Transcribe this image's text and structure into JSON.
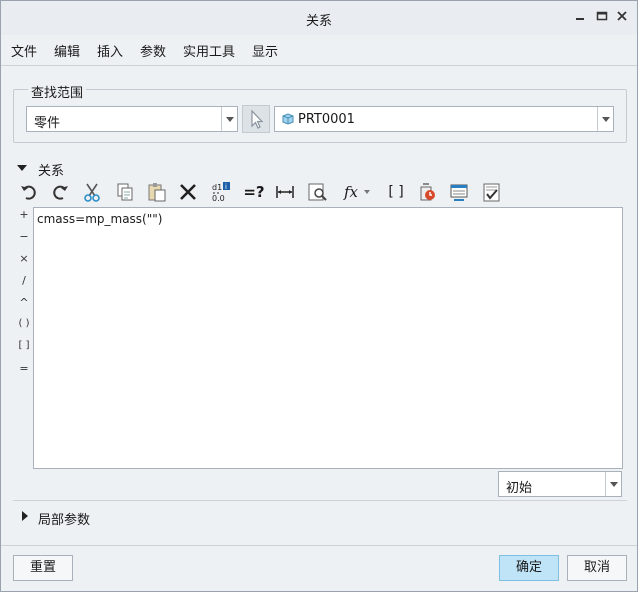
{
  "window": {
    "title": "关系"
  },
  "menu": {
    "items": [
      "文件",
      "编辑",
      "插入",
      "参数",
      "实用工具",
      "显示"
    ]
  },
  "lookin": {
    "group_label": "查找范围",
    "type_value": "零件",
    "object_value": "PRT0001"
  },
  "relations": {
    "section_label": "关系",
    "code": "cmass=mp_mass(\"\")",
    "operators": [
      "+",
      "−",
      "×",
      "/",
      "^",
      "( )",
      "[ ]",
      "="
    ],
    "status_value": "初始"
  },
  "local_params": {
    "section_label": "局部参数"
  },
  "buttons": {
    "reset": "重置",
    "ok": "确定",
    "cancel": "取消"
  },
  "toolbar": {
    "icons": [
      "undo-icon",
      "redo-icon",
      "cut-icon",
      "copy-icon",
      "paste-icon",
      "delete-icon",
      "toggle-units-icon",
      "evaluate-icon",
      "dimension-icon",
      "show-dims-icon",
      "insert-function-icon",
      "insert-from-list-icon",
      "parameter-icon",
      "sort-relations-icon",
      "verify-icon"
    ],
    "function_glyph": "fx",
    "eval_glyph": "=?",
    "bracket_glyph": "[ ]"
  }
}
